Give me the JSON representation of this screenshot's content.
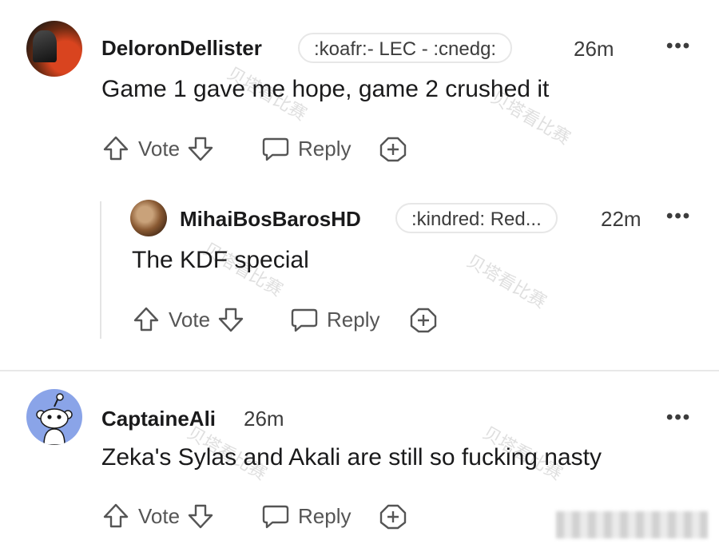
{
  "comments": [
    {
      "username": "DeloronDellister",
      "flair": ":koafr:- LEC - :cnedg:",
      "time": "26m",
      "more": "•••",
      "body": "Game 1 gave me hope, game 2 crushed it",
      "vote_label": "Vote",
      "reply_label": "Reply"
    },
    {
      "username": "MihaiBosBarosHD",
      "flair": ":kindred: Red...",
      "time": "22m",
      "more": "•••",
      "body": "The KDF special",
      "vote_label": "Vote",
      "reply_label": "Reply"
    },
    {
      "username": "CaptaineAli",
      "time": "26m",
      "more": "•••",
      "body": "Zeka's Sylas and Akali are still so fucking nasty",
      "vote_label": "Vote",
      "reply_label": "Reply"
    }
  ],
  "watermark": "贝塔看比赛",
  "icons": {
    "upvote": "arrow-up-icon",
    "downvote": "arrow-down-icon",
    "reply": "speech-bubble-icon",
    "award": "plus-circle-icon",
    "more": "more-options-icon"
  },
  "colors": {
    "text": "#1a1a1b",
    "muted": "#555555",
    "snoo_avatar_bg": "#8aa4e8"
  }
}
